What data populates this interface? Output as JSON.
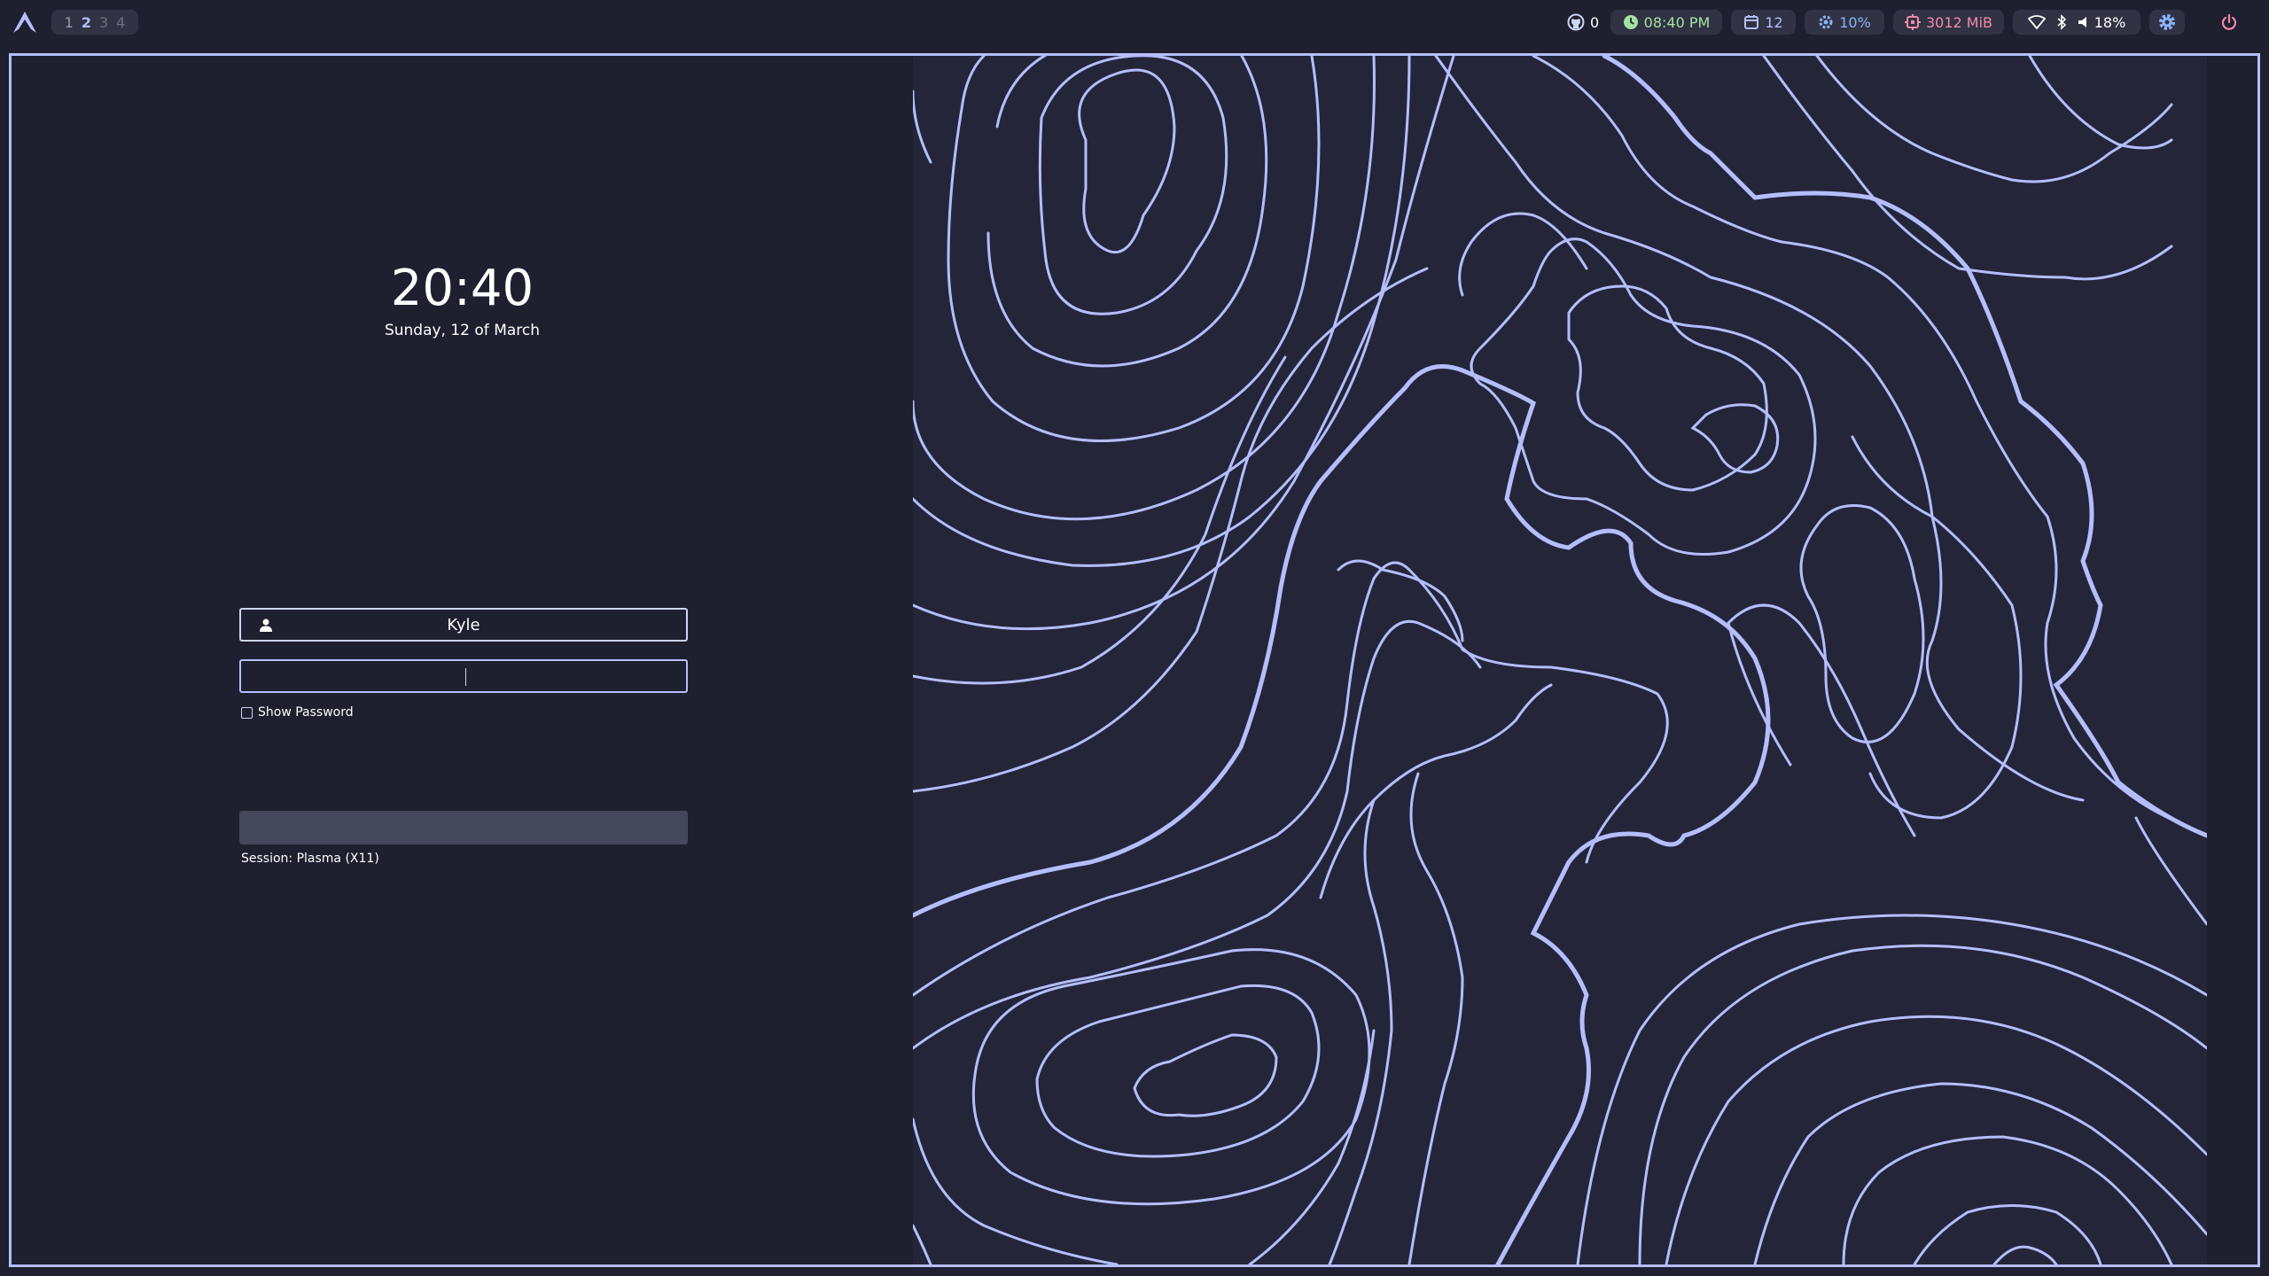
{
  "workspaces": [
    "1",
    "2",
    "3",
    "4"
  ],
  "bar": {
    "github_count": "0",
    "time": "08:40 PM",
    "calendar_day": "12",
    "cpu": "10%",
    "memory": "3012 MiB",
    "volume": "18%"
  },
  "icons": {
    "launcher": "arch-logo-icon",
    "github": "github-icon",
    "clock": "clock-icon",
    "calendar": "calendar-icon",
    "cpu": "cpu-icon",
    "memory": "memory-icon",
    "wifi": "wifi-icon",
    "bluetooth": "bluetooth-icon",
    "volume": "volume-icon",
    "settings": "gear-icon",
    "power": "power-icon",
    "user": "user-icon"
  },
  "colors": {
    "accent": "#b4befe",
    "clock_pill": "#a6e3a1",
    "cpu_pill": "#89b4fa",
    "memory_pill": "#f38ba8",
    "power": "#f38ba8",
    "background": "#1e1f2f"
  },
  "login": {
    "clock": "20:40",
    "date": "Sunday, 12 of March",
    "username": "Kyle",
    "password": "",
    "show_password_label": "Show Password",
    "session_label": "Session: Plasma (X11)"
  }
}
